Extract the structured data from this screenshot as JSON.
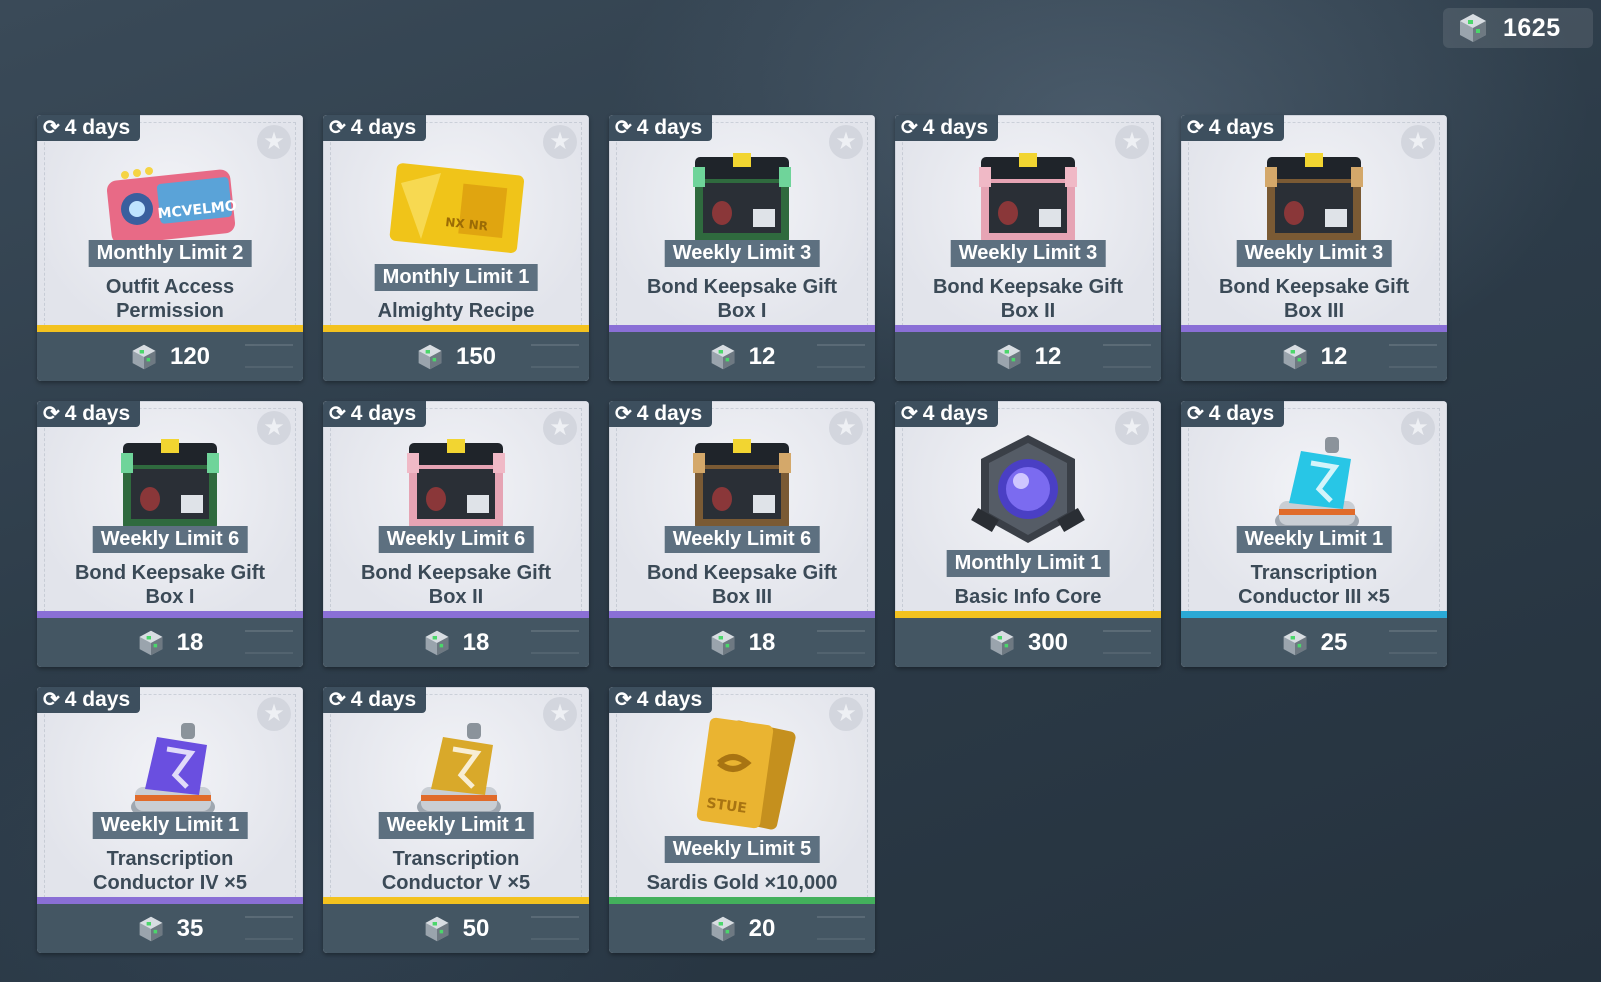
{
  "currency": {
    "amount": "1625",
    "icon": "cube-currency-icon"
  },
  "colors": {
    "purple": "#8a6fd6",
    "gold": "#f3c21f",
    "cyan": "#2ba9d6",
    "green": "#43b05c"
  },
  "items": [
    {
      "timer": "4 days",
      "limit": "Monthly Limit 2",
      "name_l1": "Outfit Access",
      "name_l2": "Permission",
      "price": "120",
      "rarity": "gold",
      "art": "pink-pass-icon"
    },
    {
      "timer": "4 days",
      "limit": "Monthly Limit 1",
      "name_l1": "Almighty Recipe",
      "name_l2": "",
      "price": "150",
      "rarity": "gold",
      "art": "gold-card-icon"
    },
    {
      "timer": "4 days",
      "limit": "Weekly Limit 3",
      "name_l1": "Bond Keepsake Gift",
      "name_l2": "Box I",
      "price": "12",
      "rarity": "purple",
      "art": "green-gift-box-icon"
    },
    {
      "timer": "4 days",
      "limit": "Weekly Limit 3",
      "name_l1": "Bond Keepsake Gift",
      "name_l2": "Box II",
      "price": "12",
      "rarity": "purple",
      "art": "pink-gift-box-icon"
    },
    {
      "timer": "4 days",
      "limit": "Weekly Limit 3",
      "name_l1": "Bond Keepsake Gift",
      "name_l2": "Box III",
      "price": "12",
      "rarity": "purple",
      "art": "brown-gift-box-icon"
    },
    {
      "timer": "4 days",
      "limit": "Weekly Limit 6",
      "name_l1": "Bond Keepsake Gift",
      "name_l2": "Box I",
      "price": "18",
      "rarity": "purple",
      "art": "green-gift-box-icon"
    },
    {
      "timer": "4 days",
      "limit": "Weekly Limit 6",
      "name_l1": "Bond Keepsake Gift",
      "name_l2": "Box II",
      "price": "18",
      "rarity": "purple",
      "art": "pink-gift-box-icon"
    },
    {
      "timer": "4 days",
      "limit": "Weekly Limit 6",
      "name_l1": "Bond Keepsake Gift",
      "name_l2": "Box III",
      "price": "18",
      "rarity": "purple",
      "art": "brown-gift-box-icon"
    },
    {
      "timer": "4 days",
      "limit": "Monthly Limit 1",
      "name_l1": "Basic Info Core",
      "name_l2": "",
      "price": "300",
      "rarity": "gold",
      "art": "info-core-icon"
    },
    {
      "timer": "4 days",
      "limit": "Weekly Limit 1",
      "name_l1": "Transcription",
      "name_l2": "Conductor III ×5",
      "price": "25",
      "rarity": "cyan",
      "art": "cyan-conductor-icon"
    },
    {
      "timer": "4 days",
      "limit": "Weekly Limit 1",
      "name_l1": "Transcription",
      "name_l2": "Conductor IV ×5",
      "price": "35",
      "rarity": "purple",
      "art": "purple-conductor-icon"
    },
    {
      "timer": "4 days",
      "limit": "Weekly Limit 1",
      "name_l1": "Transcription",
      "name_l2": "Conductor V ×5",
      "price": "50",
      "rarity": "gold",
      "art": "gold-conductor-icon"
    },
    {
      "timer": "4 days",
      "limit": "Weekly Limit 5",
      "name_l1": "Sardis Gold ×10,000",
      "name_l2": "",
      "price": "20",
      "rarity": "green",
      "art": "gold-bars-icon"
    }
  ]
}
